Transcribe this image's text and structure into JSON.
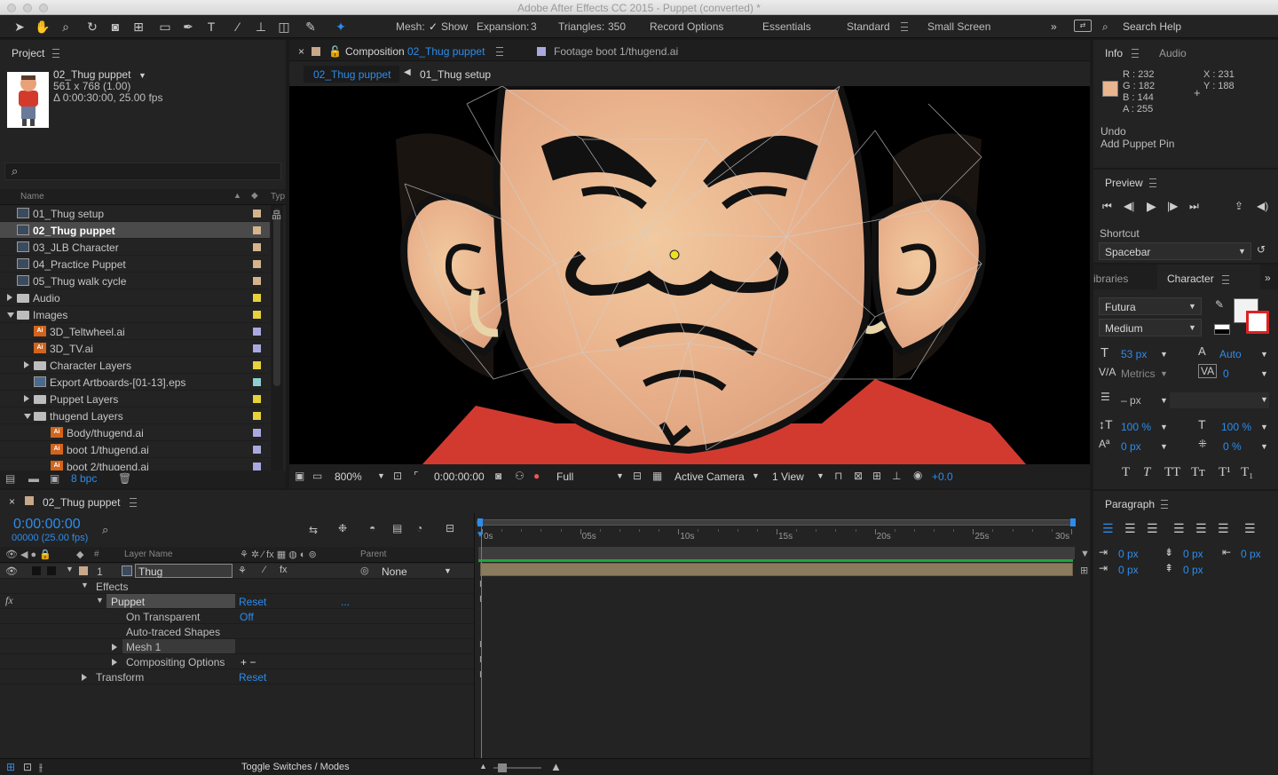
{
  "window": {
    "title": "Adobe After Effects CC 2015 - Puppet (converted) *"
  },
  "toolbar": {
    "mesh_label": "Mesh:",
    "show_label": "Show",
    "expansion_label": "Expansion:",
    "expansion_value": "3",
    "triangles_label": "Triangles:",
    "triangles_value": "350",
    "record_options": "Record Options",
    "workspaces": [
      "Essentials",
      "Standard",
      "Small Screen"
    ],
    "search_placeholder": "Search Help"
  },
  "project": {
    "tab": "Project",
    "selected_name": "02_Thug puppet",
    "selected_dims": "561 x 768 (1.00)",
    "selected_duration": "Δ 0:00:30:00, 25.00 fps",
    "col_name": "Name",
    "col_type": "Typ",
    "bpc": "8 bpc",
    "items": [
      {
        "label": "01_Thug setup",
        "icon": "comp",
        "indent": 0,
        "color": "#d4b48c"
      },
      {
        "label": "02_Thug puppet",
        "icon": "comp",
        "indent": 0,
        "color": "#d4b48c",
        "selected": true
      },
      {
        "label": "03_JLB Character",
        "icon": "comp",
        "indent": 0,
        "color": "#d4b48c"
      },
      {
        "label": "04_Practice Puppet",
        "icon": "comp",
        "indent": 0,
        "color": "#d4b48c"
      },
      {
        "label": "05_Thug walk cycle",
        "icon": "comp",
        "indent": 0,
        "color": "#d4b48c"
      },
      {
        "label": "Audio",
        "icon": "folder",
        "indent": 0,
        "color": "#e6d23c",
        "twirl": "r"
      },
      {
        "label": "Images",
        "icon": "folder",
        "indent": 0,
        "color": "#e6d23c",
        "twirl": "d"
      },
      {
        "label": "3D_Teltwheel.ai",
        "icon": "ai",
        "indent": 1,
        "color": "#a9a9e0"
      },
      {
        "label": "3D_TV.ai",
        "icon": "ai",
        "indent": 1,
        "color": "#a9a9e0"
      },
      {
        "label": "Character Layers",
        "icon": "folder",
        "indent": 1,
        "color": "#e6d23c",
        "twirl": "r"
      },
      {
        "label": "Export Artboards-[01-13].eps",
        "icon": "eps",
        "indent": 1,
        "color": "#8ed0d0"
      },
      {
        "label": "Puppet Layers",
        "icon": "folder",
        "indent": 1,
        "color": "#e6d23c",
        "twirl": "r"
      },
      {
        "label": "thugend Layers",
        "icon": "folder",
        "indent": 1,
        "color": "#e6d23c",
        "twirl": "d"
      },
      {
        "label": "Body/thugend.ai",
        "icon": "ai",
        "indent": 2,
        "color": "#a9a9e0"
      },
      {
        "label": "boot 1/thugend.ai",
        "icon": "ai",
        "indent": 2,
        "color": "#a9a9e0"
      },
      {
        "label": "boot 2/thugend.ai",
        "icon": "ai",
        "indent": 2,
        "color": "#a9a9e0"
      }
    ]
  },
  "composition": {
    "tab_prefix": "Composition",
    "tab_name": "02_Thug puppet",
    "footage_tab": "Footage boot 1/thugend.ai",
    "breadcrumb_active": "02_Thug puppet",
    "breadcrumb_parent": "01_Thug setup",
    "zoom": "800%",
    "timecode": "0:00:00:00",
    "resolution": "Full",
    "camera": "Active Camera",
    "views": "1 View",
    "exposure": "+0.0"
  },
  "info": {
    "tab": "Info",
    "audio_tab": "Audio",
    "r": "R : 232",
    "g": "G : 182",
    "b": "B : 144",
    "a": "A : 255",
    "x": "X : 231",
    "y": "Y : 188",
    "swatch": "#e8b690",
    "undo_title": "Undo",
    "undo_action": "Add Puppet Pin"
  },
  "preview": {
    "tab": "Preview",
    "shortcut_label": "Shortcut",
    "shortcut_value": "Spacebar"
  },
  "character": {
    "libraries_tab": "ibraries",
    "tab": "Character",
    "font": "Futura",
    "style": "Medium",
    "size": "53 px",
    "leading": "Auto",
    "kerning": "Metrics",
    "tracking": "0",
    "stroke": "– px",
    "vscale": "100 %",
    "hscale": "100 %",
    "baseline": "0 px",
    "tsume": "0 %"
  },
  "paragraph": {
    "tab": "Paragraph",
    "indent_left": "0 px",
    "space_before": "0 px",
    "indent_right": "0 px",
    "first_line": "0 px",
    "space_after": "0 px"
  },
  "timeline": {
    "tab": "02_Thug puppet",
    "timecode": "0:00:00:00",
    "frames": "00000 (25.00 fps)",
    "col_num": "#",
    "col_layer": "Layer Name",
    "col_parent": "Parent",
    "layer_num": "1",
    "layer_name": "Thug",
    "parent_value": "None",
    "effects": "Effects",
    "puppet": "Puppet",
    "reset": "Reset",
    "dots": "...",
    "on_transparent": "On Transparent",
    "off": "Off",
    "auto_traced": "Auto-traced Shapes",
    "mesh1": "Mesh 1",
    "compositing": "Compositing Options",
    "plusminus": "+ −",
    "transform": "Transform",
    "toggle": "Toggle Switches / Modes",
    "ruler": [
      "0s",
      "05s",
      "10s",
      "15s",
      "20s",
      "25s",
      "30s"
    ]
  }
}
